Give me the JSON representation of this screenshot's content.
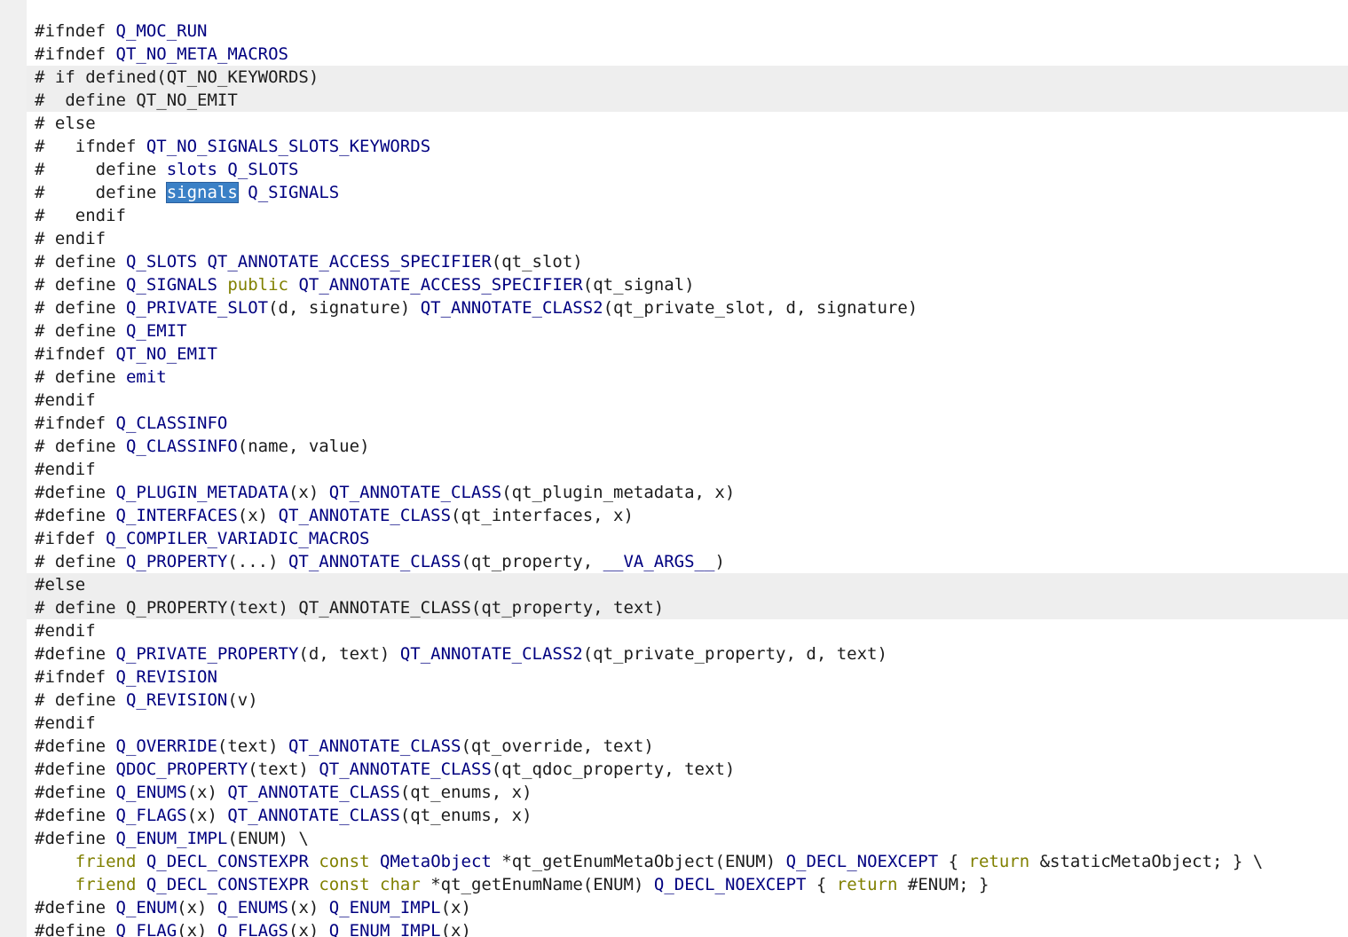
{
  "colors": {
    "gutter": "#f0f0f0",
    "current_line": "#eeeeee",
    "text": "#1c1c1c",
    "macro": "#000080",
    "keyword": "#808000",
    "selection": "#3a80c6"
  },
  "code_lines": [
    {
      "hl": false,
      "tokens": [
        {
          "t": "#ifndef "
        },
        {
          "t": "Q_MOC_RUN",
          "c": "mac"
        }
      ]
    },
    {
      "hl": false,
      "tokens": [
        {
          "t": "#ifndef "
        },
        {
          "t": "QT_NO_META_MACROS",
          "c": "mac"
        }
      ]
    },
    {
      "hl": true,
      "tokens": [
        {
          "t": "# if defined(QT_NO_KEYWORDS)"
        }
      ]
    },
    {
      "hl": true,
      "tokens": [
        {
          "t": "#  define QT_NO_EMIT"
        }
      ]
    },
    {
      "hl": false,
      "tokens": [
        {
          "t": "# else"
        }
      ]
    },
    {
      "hl": false,
      "tokens": [
        {
          "t": "#   ifndef "
        },
        {
          "t": "QT_NO_SIGNALS_SLOTS_KEYWORDS",
          "c": "mac"
        }
      ]
    },
    {
      "hl": false,
      "tokens": [
        {
          "t": "#     define "
        },
        {
          "t": "slots",
          "c": "mac"
        },
        {
          "t": " "
        },
        {
          "t": "Q_SLOTS",
          "c": "mac"
        }
      ]
    },
    {
      "hl": false,
      "tokens": [
        {
          "t": "#     define "
        },
        {
          "t": "signals",
          "c": "sel"
        },
        {
          "t": " "
        },
        {
          "t": "Q_SIGNALS",
          "c": "mac"
        }
      ]
    },
    {
      "hl": false,
      "tokens": [
        {
          "t": "#   endif"
        }
      ]
    },
    {
      "hl": false,
      "tokens": [
        {
          "t": "# endif"
        }
      ]
    },
    {
      "hl": false,
      "tokens": [
        {
          "t": "# define "
        },
        {
          "t": "Q_SLOTS",
          "c": "mac"
        },
        {
          "t": " "
        },
        {
          "t": "QT_ANNOTATE_ACCESS_SPECIFIER",
          "c": "mac"
        },
        {
          "t": "(qt_slot)"
        }
      ]
    },
    {
      "hl": false,
      "tokens": [
        {
          "t": "# define "
        },
        {
          "t": "Q_SIGNALS",
          "c": "mac"
        },
        {
          "t": " "
        },
        {
          "t": "public",
          "c": "kw"
        },
        {
          "t": " "
        },
        {
          "t": "QT_ANNOTATE_ACCESS_SPECIFIER",
          "c": "mac"
        },
        {
          "t": "(qt_signal)"
        }
      ]
    },
    {
      "hl": false,
      "tokens": [
        {
          "t": "# define "
        },
        {
          "t": "Q_PRIVATE_SLOT",
          "c": "mac"
        },
        {
          "t": "(d, signature) "
        },
        {
          "t": "QT_ANNOTATE_CLASS2",
          "c": "mac"
        },
        {
          "t": "(qt_private_slot, d, signature)"
        }
      ]
    },
    {
      "hl": false,
      "tokens": [
        {
          "t": "# define "
        },
        {
          "t": "Q_EMIT",
          "c": "mac"
        }
      ]
    },
    {
      "hl": false,
      "tokens": [
        {
          "t": "#ifndef "
        },
        {
          "t": "QT_NO_EMIT",
          "c": "mac"
        }
      ]
    },
    {
      "hl": false,
      "tokens": [
        {
          "t": "# define "
        },
        {
          "t": "emit",
          "c": "mac"
        }
      ]
    },
    {
      "hl": false,
      "tokens": [
        {
          "t": "#endif"
        }
      ]
    },
    {
      "hl": false,
      "tokens": [
        {
          "t": "#ifndef "
        },
        {
          "t": "Q_CLASSINFO",
          "c": "mac"
        }
      ]
    },
    {
      "hl": false,
      "tokens": [
        {
          "t": "# define "
        },
        {
          "t": "Q_CLASSINFO",
          "c": "mac"
        },
        {
          "t": "(name, value)"
        }
      ]
    },
    {
      "hl": false,
      "tokens": [
        {
          "t": "#endif"
        }
      ]
    },
    {
      "hl": false,
      "tokens": [
        {
          "t": "#define "
        },
        {
          "t": "Q_PLUGIN_METADATA",
          "c": "mac"
        },
        {
          "t": "(x) "
        },
        {
          "t": "QT_ANNOTATE_CLASS",
          "c": "mac"
        },
        {
          "t": "(qt_plugin_metadata, x)"
        }
      ]
    },
    {
      "hl": false,
      "tokens": [
        {
          "t": "#define "
        },
        {
          "t": "Q_INTERFACES",
          "c": "mac"
        },
        {
          "t": "(x) "
        },
        {
          "t": "QT_ANNOTATE_CLASS",
          "c": "mac"
        },
        {
          "t": "(qt_interfaces, x)"
        }
      ]
    },
    {
      "hl": false,
      "tokens": [
        {
          "t": "#ifdef "
        },
        {
          "t": "Q_COMPILER_VARIADIC_MACROS",
          "c": "mac"
        }
      ]
    },
    {
      "hl": false,
      "tokens": [
        {
          "t": "# define "
        },
        {
          "t": "Q_PROPERTY",
          "c": "mac"
        },
        {
          "t": "(...) "
        },
        {
          "t": "QT_ANNOTATE_CLASS",
          "c": "mac"
        },
        {
          "t": "(qt_property, "
        },
        {
          "t": "__VA_ARGS__",
          "c": "mac"
        },
        {
          "t": ")"
        }
      ]
    },
    {
      "hl": true,
      "tokens": [
        {
          "t": "#else"
        }
      ]
    },
    {
      "hl": true,
      "tokens": [
        {
          "t": "# define Q_PROPERTY(text) QT_ANNOTATE_CLASS(qt_property, text)"
        }
      ]
    },
    {
      "hl": false,
      "tokens": [
        {
          "t": "#endif"
        }
      ]
    },
    {
      "hl": false,
      "tokens": [
        {
          "t": "#define "
        },
        {
          "t": "Q_PRIVATE_PROPERTY",
          "c": "mac"
        },
        {
          "t": "(d, text) "
        },
        {
          "t": "QT_ANNOTATE_CLASS2",
          "c": "mac"
        },
        {
          "t": "(qt_private_property, d, text)"
        }
      ]
    },
    {
      "hl": false,
      "tokens": [
        {
          "t": "#ifndef "
        },
        {
          "t": "Q_REVISION",
          "c": "mac"
        }
      ]
    },
    {
      "hl": false,
      "tokens": [
        {
          "t": "# define "
        },
        {
          "t": "Q_REVISION",
          "c": "mac"
        },
        {
          "t": "(v)"
        }
      ]
    },
    {
      "hl": false,
      "tokens": [
        {
          "t": "#endif"
        }
      ]
    },
    {
      "hl": false,
      "tokens": [
        {
          "t": "#define "
        },
        {
          "t": "Q_OVERRIDE",
          "c": "mac"
        },
        {
          "t": "(text) "
        },
        {
          "t": "QT_ANNOTATE_CLASS",
          "c": "mac"
        },
        {
          "t": "(qt_override, text)"
        }
      ]
    },
    {
      "hl": false,
      "tokens": [
        {
          "t": "#define "
        },
        {
          "t": "QDOC_PROPERTY",
          "c": "mac"
        },
        {
          "t": "(text) "
        },
        {
          "t": "QT_ANNOTATE_CLASS",
          "c": "mac"
        },
        {
          "t": "(qt_qdoc_property, text)"
        }
      ]
    },
    {
      "hl": false,
      "tokens": [
        {
          "t": "#define "
        },
        {
          "t": "Q_ENUMS",
          "c": "mac"
        },
        {
          "t": "(x) "
        },
        {
          "t": "QT_ANNOTATE_CLASS",
          "c": "mac"
        },
        {
          "t": "(qt_enums, x)"
        }
      ]
    },
    {
      "hl": false,
      "tokens": [
        {
          "t": "#define "
        },
        {
          "t": "Q_FLAGS",
          "c": "mac"
        },
        {
          "t": "(x) "
        },
        {
          "t": "QT_ANNOTATE_CLASS",
          "c": "mac"
        },
        {
          "t": "(qt_enums, x)"
        }
      ]
    },
    {
      "hl": false,
      "tokens": [
        {
          "t": "#define "
        },
        {
          "t": "Q_ENUM_IMPL",
          "c": "mac"
        },
        {
          "t": "(ENUM) \\"
        }
      ]
    },
    {
      "hl": false,
      "tokens": [
        {
          "t": "    "
        },
        {
          "t": "friend",
          "c": "kw"
        },
        {
          "t": " "
        },
        {
          "t": "Q_DECL_CONSTEXPR",
          "c": "mac"
        },
        {
          "t": " "
        },
        {
          "t": "const",
          "c": "kw"
        },
        {
          "t": " "
        },
        {
          "t": "QMetaObject",
          "c": "mac"
        },
        {
          "t": " *qt_getEnumMetaObject(ENUM) "
        },
        {
          "t": "Q_DECL_NOEXCEPT",
          "c": "mac"
        },
        {
          "t": " { "
        },
        {
          "t": "return",
          "c": "kw"
        },
        {
          "t": " &staticMetaObject; } \\"
        }
      ]
    },
    {
      "hl": false,
      "tokens": [
        {
          "t": "    "
        },
        {
          "t": "friend",
          "c": "kw"
        },
        {
          "t": " "
        },
        {
          "t": "Q_DECL_CONSTEXPR",
          "c": "mac"
        },
        {
          "t": " "
        },
        {
          "t": "const",
          "c": "kw"
        },
        {
          "t": " "
        },
        {
          "t": "char",
          "c": "kw"
        },
        {
          "t": " *qt_getEnumName(ENUM) "
        },
        {
          "t": "Q_DECL_NOEXCEPT",
          "c": "mac"
        },
        {
          "t": " { "
        },
        {
          "t": "return",
          "c": "kw"
        },
        {
          "t": " #ENUM; }"
        }
      ]
    },
    {
      "hl": false,
      "tokens": [
        {
          "t": "#define "
        },
        {
          "t": "Q_ENUM",
          "c": "mac"
        },
        {
          "t": "(x) "
        },
        {
          "t": "Q_ENUMS",
          "c": "mac"
        },
        {
          "t": "(x) "
        },
        {
          "t": "Q_ENUM_IMPL",
          "c": "mac"
        },
        {
          "t": "(x)"
        }
      ]
    },
    {
      "hl": false,
      "tokens": [
        {
          "t": "#define "
        },
        {
          "t": "Q_FLAG",
          "c": "mac"
        },
        {
          "t": "(x) "
        },
        {
          "t": "Q_FLAGS",
          "c": "mac"
        },
        {
          "t": "(x) "
        },
        {
          "t": "Q_ENUM_IMPL",
          "c": "mac"
        },
        {
          "t": "(x)"
        }
      ]
    }
  ]
}
